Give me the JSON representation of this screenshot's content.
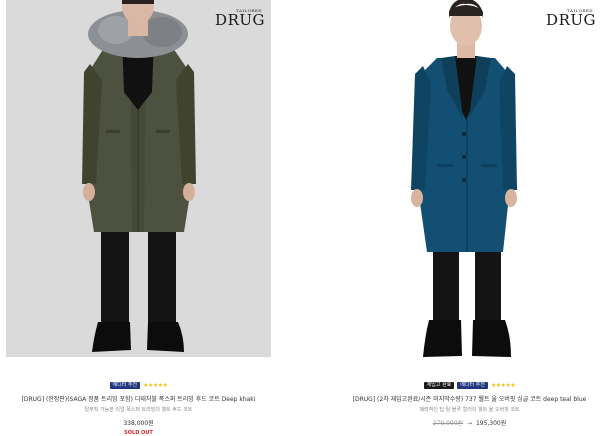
{
  "products": [
    {
      "brand_tag": "TAILORED",
      "brand_name": "DRUG",
      "badges": [
        "에디터 추천"
      ],
      "stars": "★★★★★",
      "title": "[DRUG] (한정판)(SAGA 정품 트리밍 포함) 디태처블 폭스퍼 트리밍 후드 코트 Deep khaki",
      "subtitle": "탈부착 가능한 리얼 폭스퍼 트리밍의 웰트 후드 코트",
      "price": "338,000원",
      "status": "SOLD OUT",
      "coat_color": "#4c5140"
    },
    {
      "brand_tag": "TAILORED",
      "brand_name": "DRUG",
      "badges": [
        "재입고 완료",
        "에디터 추천"
      ],
      "stars": "★★★★★",
      "title": "[DRUG] (2차 재입고완료/시즌 마지막수량) 737 웰트 울 오버핏 싱글 코트 deep teal blue",
      "subtitle": "매력적인 딥 틸 블루 컬러의 웰트 울 오버핏 코트",
      "old_price": "279,000원",
      "arrow": "→",
      "price": "195,300원",
      "coat_color": "#124f72"
    }
  ]
}
